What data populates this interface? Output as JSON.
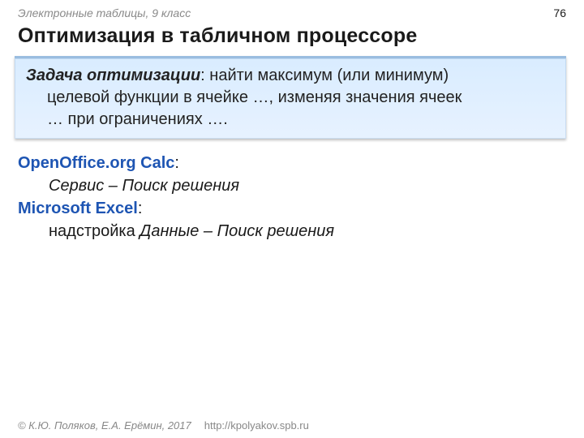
{
  "header": {
    "course_label": "Электронные таблицы, 9 класс",
    "page_number": "76",
    "title": "Оптимизация в табличном процессоре"
  },
  "callout": {
    "lead": "Задача оптимизации",
    "colon": ": ",
    "line1_rest": "найти максимум (или минимум)",
    "line2": "целевой функции в ячейке …, изменяя значения ячеек",
    "line3": "… при ограничениях …."
  },
  "content": {
    "openoffice": {
      "name": "OpenOffice.org Calc",
      "colon": ":",
      "path": "Сервис – Поиск решения"
    },
    "excel": {
      "name": "Microsoft Excel",
      "colon": ":",
      "addon_word": "надстройка ",
      "path": "Данные – Поиск решения"
    }
  },
  "footer": {
    "copyright": "© К.Ю. Поляков, Е.А. Ерёмин, 2017",
    "url": "http://kpolyakov.spb.ru"
  }
}
